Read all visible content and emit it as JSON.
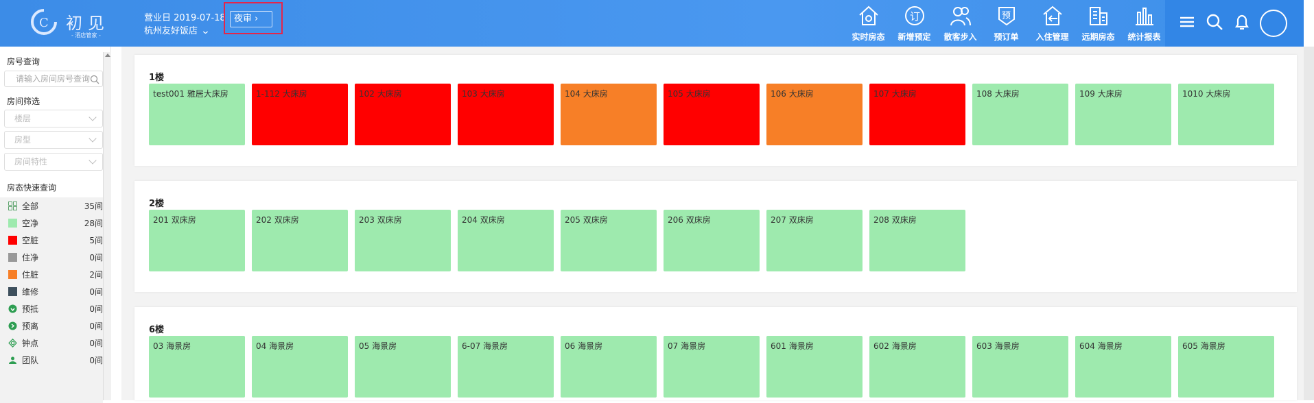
{
  "colors": {
    "header": "#3c8ce7",
    "clean": "#9eeaae",
    "dirty": "#ff0000",
    "occupied_clean": "#999999",
    "occupied_dirty": "#f77f27",
    "repair": "#3d4f5c"
  },
  "logo": {
    "name": "初见",
    "sub": "- 酒店管家 -"
  },
  "header": {
    "business_date": "营业日 2019-07-18",
    "hotel": "杭州友好饭店",
    "audit": "夜审"
  },
  "nav": [
    {
      "label": "实时房态",
      "icon": "house-icon"
    },
    {
      "label": "新增预定",
      "icon": "booking-icon"
    },
    {
      "label": "散客步入",
      "icon": "guests-icon"
    },
    {
      "label": "预订单",
      "icon": "order-icon"
    },
    {
      "label": "入住管理",
      "icon": "checkin-icon"
    },
    {
      "label": "远期房态",
      "icon": "calendar-icon"
    },
    {
      "label": "统计报表",
      "icon": "chart-icon"
    }
  ],
  "sidebar": {
    "search_title": "房号查询",
    "search_placeholder": "请输入房间房号查询",
    "filter_title": "房间筛选",
    "floor": "楼层",
    "room_type": "房型",
    "feature": "房间特性",
    "quick_title": "房态快速查询",
    "quick": [
      {
        "label": "全部",
        "count": "35间",
        "icon": "grid-icon"
      },
      {
        "label": "空净",
        "count": "28间",
        "icon": "clean-swatch"
      },
      {
        "label": "空脏",
        "count": "5间",
        "icon": "dirty-swatch"
      },
      {
        "label": "住净",
        "count": "0间",
        "icon": "occupied-clean-swatch"
      },
      {
        "label": "住脏",
        "count": "2间",
        "icon": "occupied-dirty-swatch"
      },
      {
        "label": "维修",
        "count": "0间",
        "icon": "repair-swatch"
      },
      {
        "label": "预抵",
        "count": "0间",
        "icon": "arrival-icon"
      },
      {
        "label": "预离",
        "count": "0间",
        "icon": "departure-icon"
      },
      {
        "label": "钟点",
        "count": "0间",
        "icon": "hourly-icon"
      },
      {
        "label": "团队",
        "count": "0间",
        "icon": "team-icon"
      }
    ]
  },
  "floors": [
    {
      "title": "1楼",
      "rooms": [
        {
          "name": "test001 雅居大床房",
          "status": "clean"
        },
        {
          "name": "1-112 大床房",
          "status": "dirty"
        },
        {
          "name": "102 大床房",
          "status": "dirty"
        },
        {
          "name": "103 大床房",
          "status": "dirty"
        },
        {
          "name": "104 大床房",
          "status": "occdirty"
        },
        {
          "name": "105 大床房",
          "status": "dirty"
        },
        {
          "name": "106 大床房",
          "status": "occdirty"
        },
        {
          "name": "107 大床房",
          "status": "dirty"
        },
        {
          "name": "108 大床房",
          "status": "clean"
        },
        {
          "name": "109 大床房",
          "status": "clean"
        },
        {
          "name": "1010 大床房",
          "status": "clean"
        }
      ]
    },
    {
      "title": "2楼",
      "rooms": [
        {
          "name": "201 双床房",
          "status": "clean"
        },
        {
          "name": "202 双床房",
          "status": "clean"
        },
        {
          "name": "203 双床房",
          "status": "clean"
        },
        {
          "name": "204 双床房",
          "status": "clean"
        },
        {
          "name": "205 双床房",
          "status": "clean"
        },
        {
          "name": "206 双床房",
          "status": "clean"
        },
        {
          "name": "207 双床房",
          "status": "clean"
        },
        {
          "name": "208 双床房",
          "status": "clean"
        }
      ]
    },
    {
      "title": "6楼",
      "rooms": [
        {
          "name": "03 海景房",
          "status": "clean"
        },
        {
          "name": "04 海景房",
          "status": "clean"
        },
        {
          "name": "05 海景房",
          "status": "clean"
        },
        {
          "name": "6-07 海景房",
          "status": "clean"
        },
        {
          "name": "06 海景房",
          "status": "clean"
        },
        {
          "name": "07 海景房",
          "status": "clean"
        },
        {
          "name": "601 海景房",
          "status": "clean"
        },
        {
          "name": "602 海景房",
          "status": "clean"
        },
        {
          "name": "603 海景房",
          "status": "clean"
        },
        {
          "name": "604 海景房",
          "status": "clean"
        },
        {
          "name": "605 海景房",
          "status": "clean"
        }
      ]
    }
  ]
}
